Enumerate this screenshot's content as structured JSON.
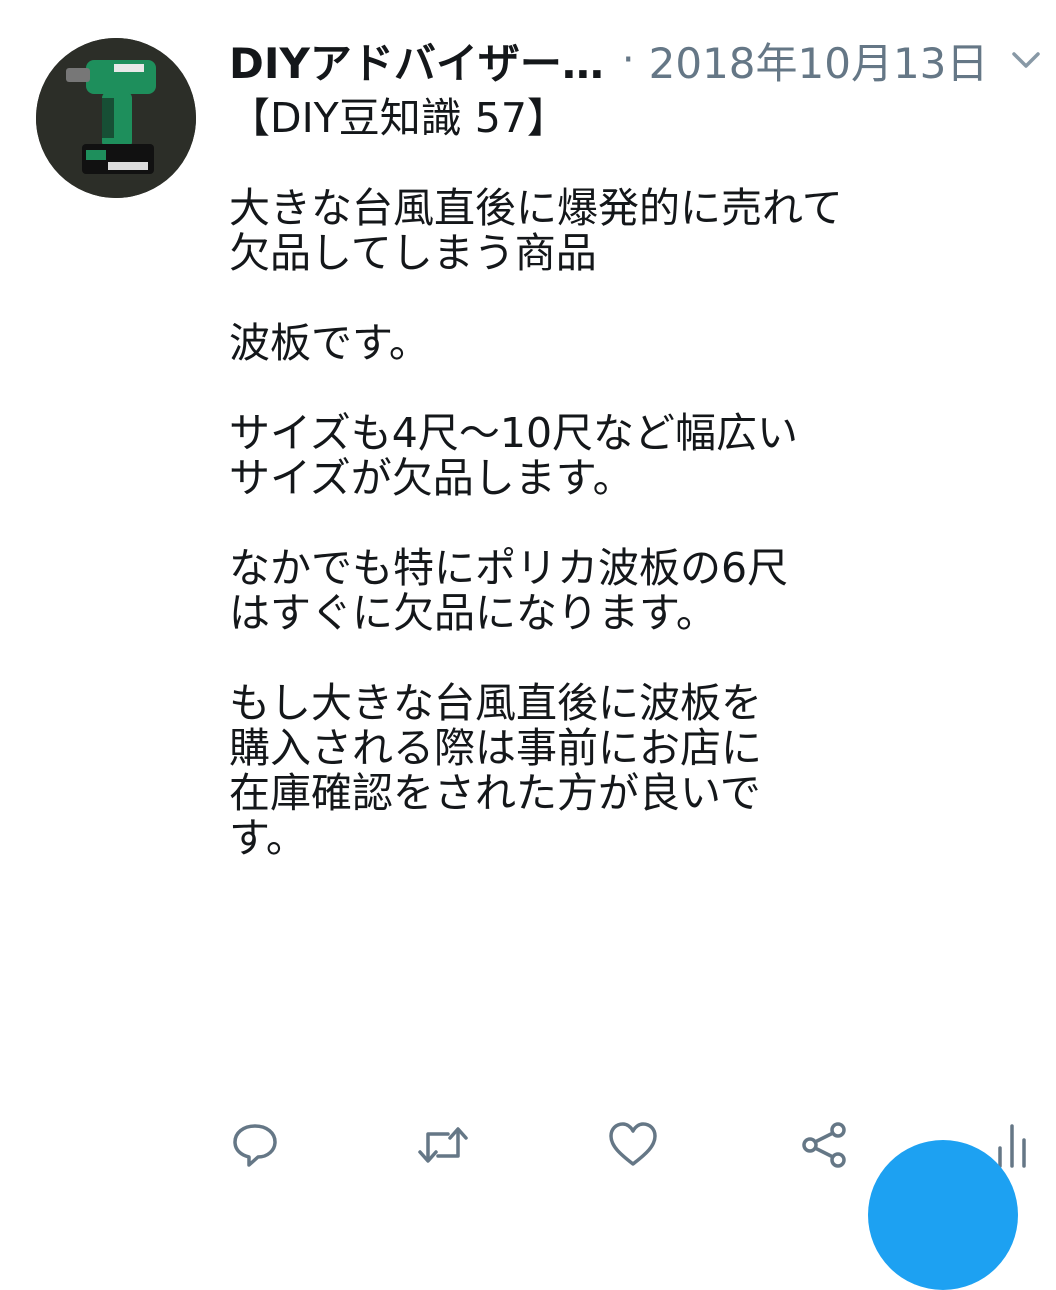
{
  "tweet": {
    "author": "DIYアドバイザー…",
    "separator": "·",
    "date": "2018年10月13日",
    "paragraphs": [
      "【DIY豆知識 57】",
      "大きな台風直後に爆発的に売れて\n欠品してしまう商品",
      "波板です。",
      "サイズも4尺～10尺など幅広い\nサイズが欠品します。",
      "なかでも特にポリカ波板の6尺\nはすぐに欠品になります。",
      "もし大きな台風直後に波板を\n購入される際は事前にお店に\n在庫確認をされた方が良いで\nす。"
    ]
  },
  "icons": {
    "avatar": "drill-photo-avatar",
    "menu": "chevron-down-icon",
    "reply": "reply-icon",
    "retweet": "retweet-icon",
    "like": "heart-icon",
    "share": "share-icon",
    "analytics": "analytics-icon",
    "compose": "compose-fab"
  },
  "colors": {
    "text": "#14171a",
    "secondary": "#657786",
    "accent": "#1da1f2"
  }
}
